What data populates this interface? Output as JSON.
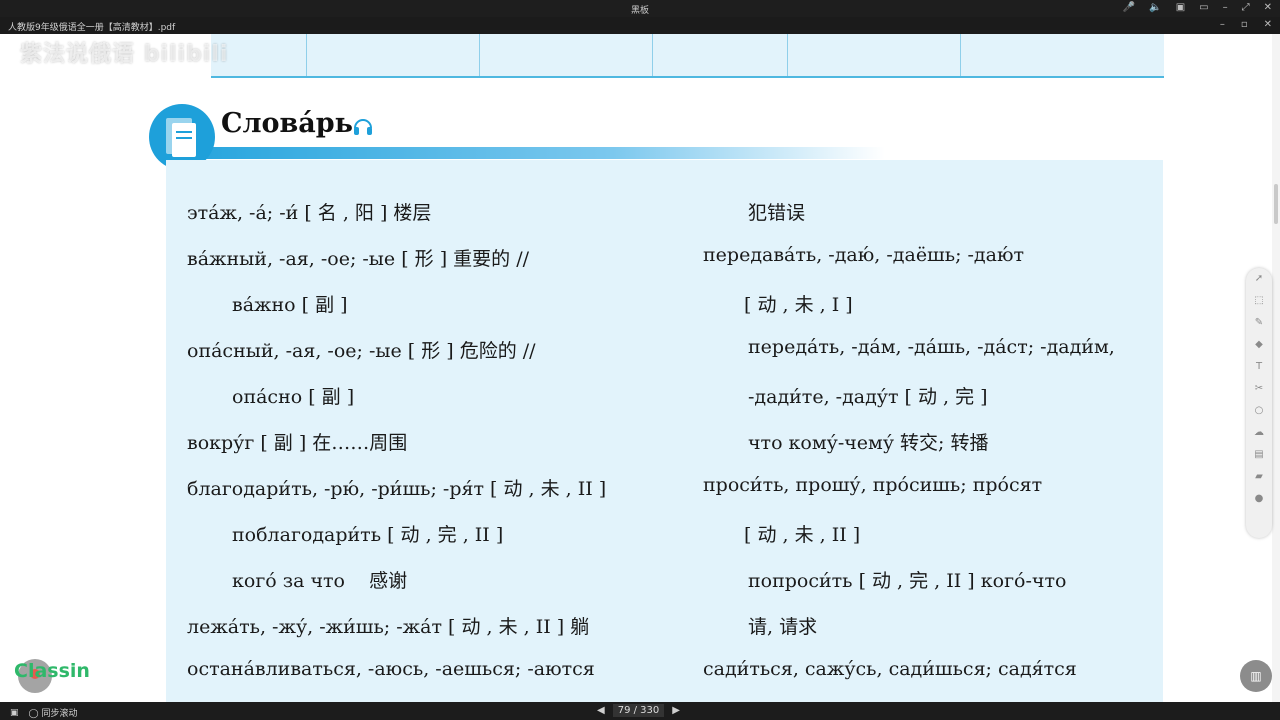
{
  "window": {
    "title": "黑板",
    "doc_tab": "人教版9年级俄语全一册【高清教材】.pdf"
  },
  "watermark": "紫法说俄语 bilibili",
  "bottom_bar": {
    "sync_label": "同步滚动",
    "page_current": "79",
    "page_total": "330",
    "page_display": "79 / 330"
  },
  "vocab": {
    "title": "Слова́рь",
    "left": [
      "эта́ж, -а́; -и́ [ 名 , 阳 ] 楼层",
      "ва́жный, -ая, -ое; -ые [ 形 ] 重要的 //",
      "ва́жно [ 副 ]",
      "опа́сный, -ая, -ое; -ые [ 形 ] 危险的 //",
      "опа́сно [ 副 ]",
      "вокру́г [ 副 ] 在……周围",
      "благодари́ть, -рю́, -ри́шь; -ря́т [ 动 , 未 , II ]",
      "поблагодари́ть [ 动 , 完 , II ]",
      "кого́ за что    感谢",
      "лежа́ть, -жу́, -жи́шь; -жа́т [ 动 , 未 , II ] 躺",
      "остана́вливаться, -аюсь, -аешься; -аются"
    ],
    "right": [
      "犯错误",
      "передава́ть, -даю́, -даёшь; -даю́т",
      "[ 动 , 未 , I ]",
      "переда́ть, -да́м, -да́шь, -да́ст; -дади́м,",
      "-дади́те, -даду́т [ 动 , 完 ]",
      "что кому́-чему́ 转交; 转播",
      "проси́ть, прошу́, про́сишь; про́сят",
      "[ 动 , 未 , II ]",
      "попроси́ть [ 动 , 完 , II ] кого́-что",
      "请, 请求",
      "сади́ться, сажу́сь, сади́шься; садя́тся"
    ]
  },
  "tools": [
    "pointer-icon",
    "select-icon",
    "pen-icon",
    "eraser-icon",
    "text-icon",
    "scissors-icon",
    "shape-icon",
    "cloud-icon",
    "folder-icon",
    "chat-icon",
    "user-icon"
  ],
  "classin_logo": "Classin",
  "colors": {
    "accent_blue": "#1ea0da",
    "content_bg": "#e2f3fb",
    "brand_green": "#2fb86a"
  }
}
